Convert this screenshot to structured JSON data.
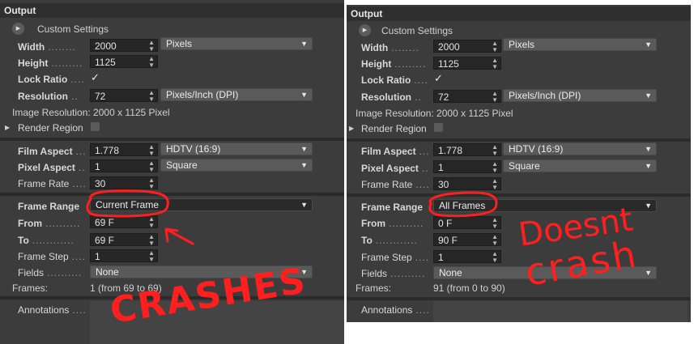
{
  "panels": [
    {
      "title": "Output",
      "custom_settings": "Custom Settings",
      "width_label": "Width",
      "width_value": "2000",
      "width_unit": "Pixels",
      "height_label": "Height",
      "height_value": "1125",
      "lock_ratio_label": "Lock Ratio",
      "lock_ratio_check": "✓",
      "resolution_label": "Resolution",
      "resolution_value": "72",
      "resolution_unit": "Pixels/Inch (DPI)",
      "image_resolution": "Image Resolution: 2000 x 1125 Pixel",
      "render_region_label": "Render Region",
      "film_aspect_label": "Film Aspect",
      "film_aspect_value": "1.778",
      "film_aspect_preset": "HDTV (16:9)",
      "pixel_aspect_label": "Pixel Aspect",
      "pixel_aspect_value": "1",
      "pixel_aspect_preset": "Square",
      "frame_rate_label": "Frame Rate",
      "frame_rate_value": "30",
      "frame_range_label": "Frame Range",
      "frame_range_value": "Current Frame",
      "from_label": "From",
      "from_value": "69 F",
      "to_label": "To",
      "to_value": "69 F",
      "frame_step_label": "Frame Step",
      "frame_step_value": "1",
      "fields_label": "Fields",
      "fields_value": "None",
      "frames_label": "Frames:",
      "frames_value": "1 (from 69 to 69)",
      "annotations_label": "Annotations"
    },
    {
      "title": "Output",
      "custom_settings": "Custom Settings",
      "width_label": "Width",
      "width_value": "2000",
      "width_unit": "Pixels",
      "height_label": "Height",
      "height_value": "1125",
      "lock_ratio_label": "Lock Ratio",
      "lock_ratio_check": "✓",
      "resolution_label": "Resolution",
      "resolution_value": "72",
      "resolution_unit": "Pixels/Inch (DPI)",
      "image_resolution": "Image Resolution: 2000 x 1125 Pixel",
      "render_region_label": "Render Region",
      "film_aspect_label": "Film Aspect",
      "film_aspect_value": "1.778",
      "film_aspect_preset": "HDTV (16:9)",
      "pixel_aspect_label": "Pixel Aspect",
      "pixel_aspect_value": "1",
      "pixel_aspect_preset": "Square",
      "frame_rate_label": "Frame Rate",
      "frame_rate_value": "30",
      "frame_range_label": "Frame Range",
      "frame_range_value": "All Frames",
      "from_label": "From",
      "from_value": "0 F",
      "to_label": "To",
      "to_value": "90 F",
      "frame_step_label": "Frame Step",
      "frame_step_value": "1",
      "fields_label": "Fields",
      "fields_value": "None",
      "frames_label": "Frames:",
      "frames_value": "91 (from 0 to 90)",
      "annotations_label": "Annotations"
    }
  ],
  "handwritten_notes": {
    "left": "CRASHES",
    "right_line1": "Doesnt",
    "right_line2": "crash"
  },
  "colors": {
    "annotation_ink": "#ff1f1f",
    "panel_bg": "#3c3c3c"
  },
  "icons": {
    "spinner": "spinner-arrows-icon",
    "dropdown": "chevron-down-icon",
    "expand": "play-toggle-icon"
  }
}
